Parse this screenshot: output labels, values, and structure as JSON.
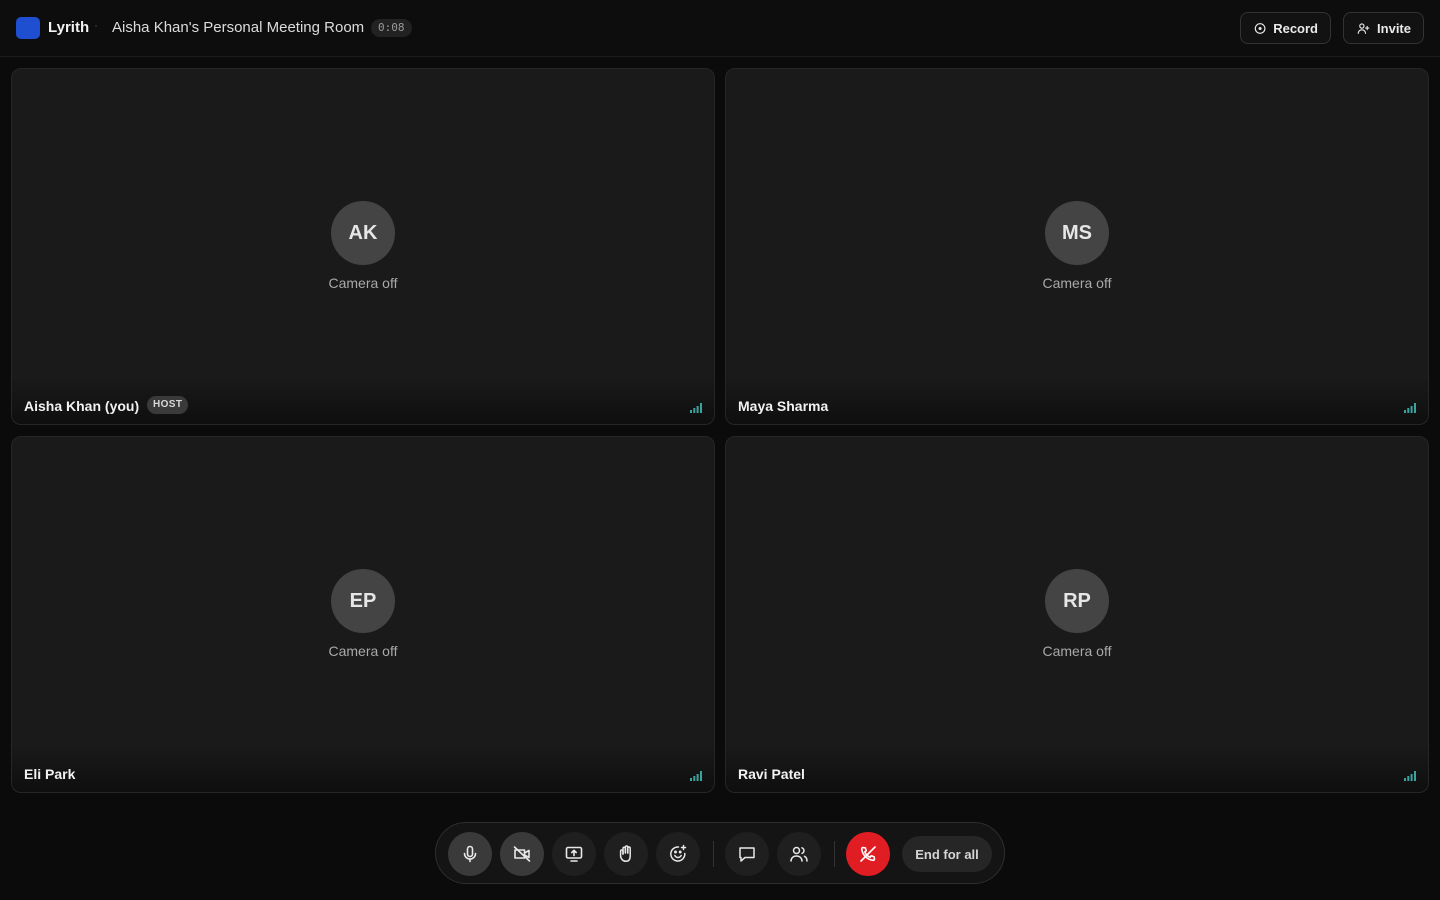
{
  "app": {
    "name": "Lyrith",
    "separator": "·",
    "room_title": "Aisha Khan's Personal Meeting Room",
    "timer": "0:08",
    "brand_color": "#1f4fd1"
  },
  "header_actions": {
    "record_label": "Record",
    "invite_label": "Invite"
  },
  "participants": [
    {
      "initials": "AK",
      "name": "Aisha Khan (you)",
      "status": "Camera off",
      "badge": "HOST"
    },
    {
      "initials": "MS",
      "name": "Maya Sharma",
      "status": "Camera off"
    },
    {
      "initials": "EP",
      "name": "Eli Park",
      "status": "Camera off"
    },
    {
      "initials": "RP",
      "name": "Ravi Patel",
      "status": "Camera off"
    }
  ],
  "controls": {
    "icons": [
      "mic-icon",
      "video-off-icon",
      "screen-share-icon",
      "raise-hand-icon",
      "reaction-icon",
      "chat-icon",
      "participants-icon",
      "leave-call-icon"
    ],
    "end_for_all_label": "End for all",
    "leave_color": "#e11d24",
    "signal_color": "#3aa3a0"
  }
}
